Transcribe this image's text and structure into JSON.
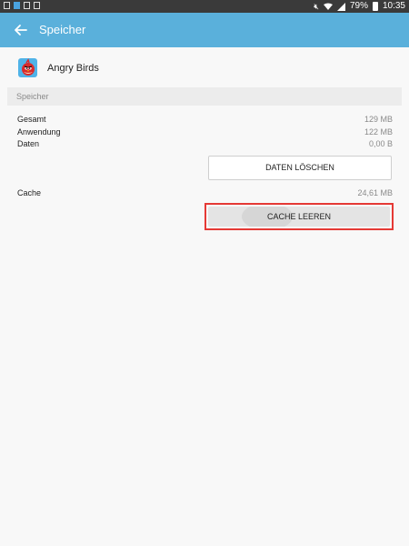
{
  "status_bar": {
    "battery": "79%",
    "time": "10:35",
    "icons": [
      "gallery-icon",
      "notification-icon",
      "lock-icon",
      "sync-icon",
      "mute-icon",
      "wifi-icon",
      "signal-icon",
      "battery-icon"
    ]
  },
  "app_bar": {
    "title": "Speicher",
    "back_icon": "arrow-left-icon",
    "color": "#5ab0db"
  },
  "app": {
    "name": "Angry Birds",
    "icon": "angry-birds-app-icon"
  },
  "storage": {
    "section_title": "Speicher",
    "rows": [
      {
        "label": "Gesamt",
        "value": "129 MB"
      },
      {
        "label": "Anwendung",
        "value": "122 MB"
      },
      {
        "label": "Daten",
        "value": "0,00 B"
      }
    ],
    "clear_data_label": "DATEN LÖSCHEN",
    "cache_label": "Cache",
    "cache_value": "24,61 MB",
    "clear_cache_label": "CACHE LEEREN",
    "highlight_color": "#e53935"
  }
}
